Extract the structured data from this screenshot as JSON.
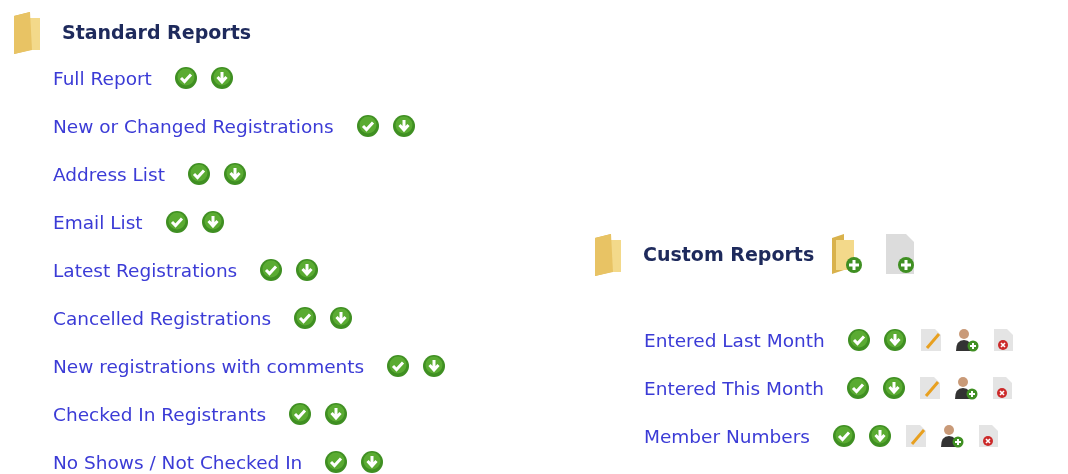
{
  "standard_reports": {
    "title": "Standard Reports",
    "items": [
      {
        "label": "Full Report"
      },
      {
        "label": "New or Changed Registrations"
      },
      {
        "label": "Address List"
      },
      {
        "label": "Email List"
      },
      {
        "label": "Latest Registrations"
      },
      {
        "label": "Cancelled Registrations"
      },
      {
        "label": "New registrations with comments"
      },
      {
        "label": "Checked In Registrants"
      },
      {
        "label": "No Shows / Not Checked In"
      }
    ]
  },
  "custom_reports": {
    "title": "Custom Reports",
    "items": [
      {
        "label": "Entered Last Month"
      },
      {
        "label": "Entered This Month"
      },
      {
        "label": "Member Numbers"
      }
    ]
  }
}
